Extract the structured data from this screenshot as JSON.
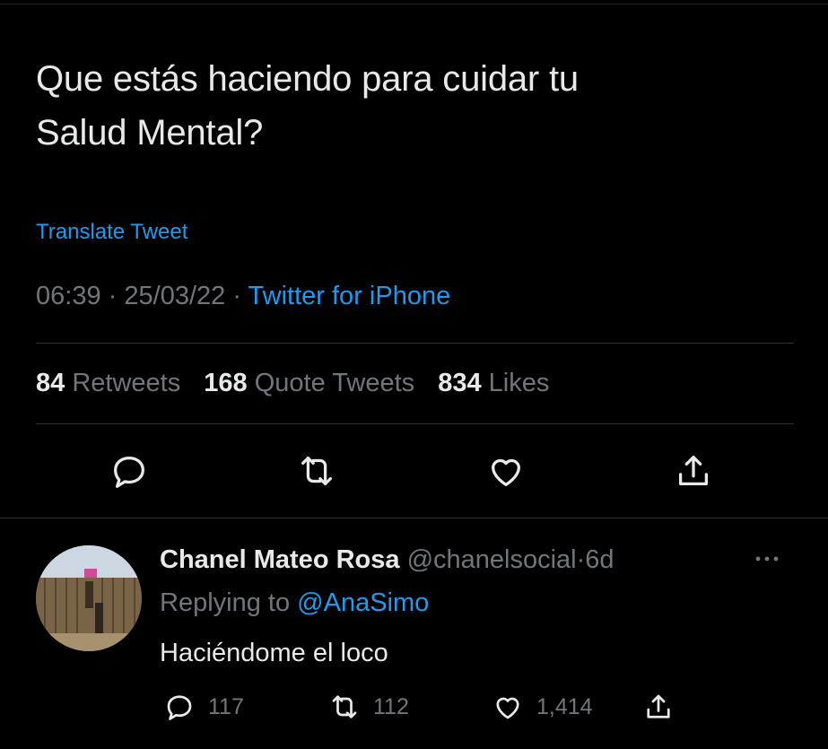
{
  "tweet": {
    "text_line1": "Que estás haciendo para cuidar tu",
    "text_line2": "Salud Mental?",
    "translate_label": "Translate Tweet",
    "time": "06:39",
    "date": "25/03/22",
    "separator": "·",
    "source": "Twitter for iPhone"
  },
  "stats": {
    "retweets_count": "84",
    "retweets_label": "Retweets",
    "quotes_count": "168",
    "quotes_label": "Quote Tweets",
    "likes_count": "834",
    "likes_label": "Likes"
  },
  "actions": {
    "icons": [
      "reply-icon",
      "retweet-icon",
      "like-icon",
      "share-icon"
    ]
  },
  "reply": {
    "name": "Chanel Mateo Rosa",
    "handle": "@chanelsocial",
    "separator": "·",
    "age": "6d",
    "replying_prefix": "Replying to",
    "replying_to": "@AnaSimo",
    "text": "Haciéndome el loco",
    "reply_count": "117",
    "retweet_count": "112",
    "like_count": "1,414"
  },
  "colors": {
    "background": "#000000",
    "text": "#e7e9ea",
    "muted": "#71767b",
    "accent": "#1d9bf0"
  }
}
